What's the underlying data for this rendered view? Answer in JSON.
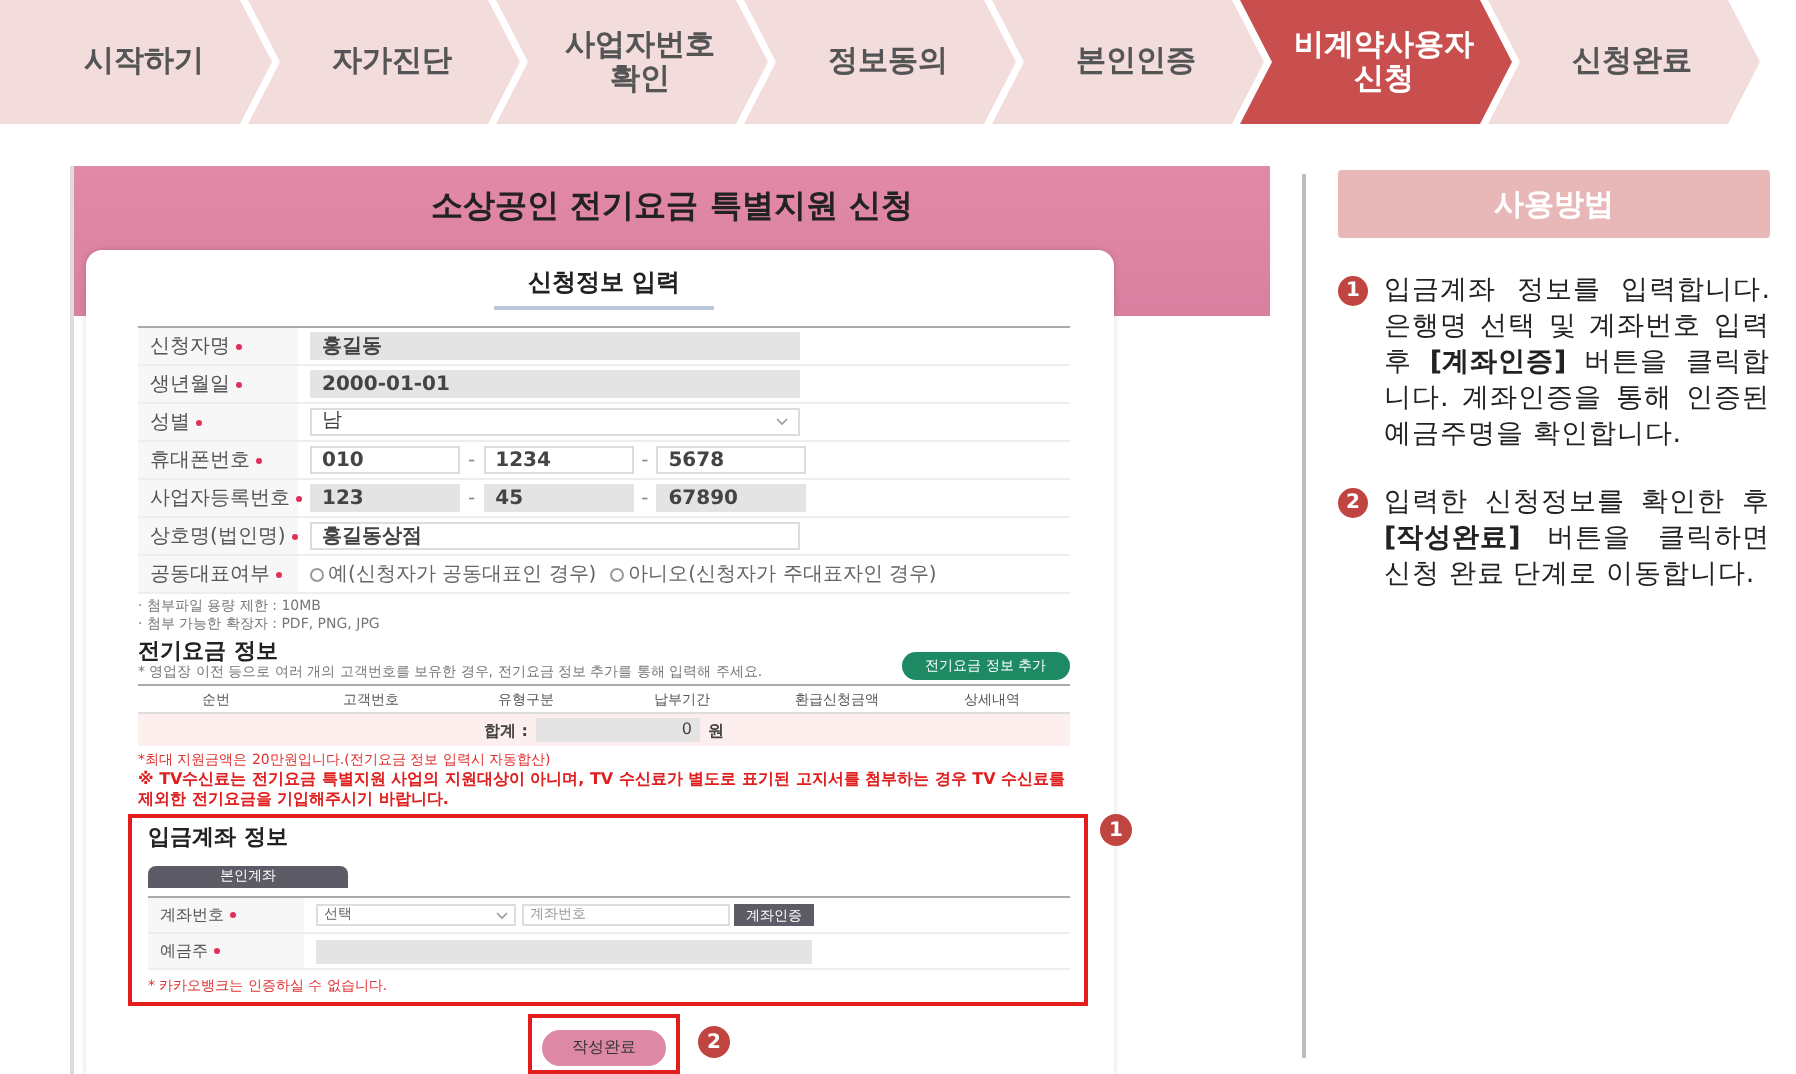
{
  "steps": [
    {
      "label": "시작하기",
      "selected": false
    },
    {
      "label": "자가진단",
      "selected": false
    },
    {
      "label": "사업자번호\n확인",
      "selected": false
    },
    {
      "label": "정보동의",
      "selected": false
    },
    {
      "label": "본인인증",
      "selected": false
    },
    {
      "label": "비계약사용자\n신청",
      "selected": true
    },
    {
      "label": "신청완료",
      "selected": false
    }
  ],
  "form": {
    "page_title": "소상공인 전기요금 특별지원 신청",
    "section_title": "신청정보 입력",
    "fields": [
      {
        "kind": "text",
        "label": "신청자명",
        "required": true,
        "disabled": true,
        "values": [
          "홍길동"
        ]
      },
      {
        "kind": "text",
        "label": "생년월일",
        "required": true,
        "disabled": true,
        "values": [
          "2000-01-01"
        ]
      },
      {
        "kind": "select",
        "label": "성별",
        "required": true,
        "disabled": false,
        "values": [
          "남"
        ]
      },
      {
        "kind": "split",
        "label": "휴대폰번호",
        "required": true,
        "disabled": false,
        "separator": "-",
        "values": [
          "010",
          "1234",
          "5678"
        ]
      },
      {
        "kind": "split",
        "label": "사업자등록번호",
        "required": true,
        "disabled": true,
        "separator": "-",
        "values": [
          "123",
          "45",
          "67890"
        ]
      },
      {
        "kind": "text",
        "label": "상호명(법인명)",
        "required": true,
        "disabled": false,
        "values": [
          "홍길동상점"
        ]
      },
      {
        "kind": "radio",
        "label": "공동대표여부",
        "required": true,
        "options": [
          {
            "label": "예(신청자가 공동대표인 경우)",
            "selected": false
          },
          {
            "label": "아니오(신청자가 주대표자인 경우)",
            "selected": false
          }
        ]
      }
    ],
    "file_notes": [
      "· 첨부파일 용량 제한 : 10MB",
      "· 첨부 가능한 확장자 : PDF, PNG, JPG"
    ],
    "bill": {
      "title": "전기요금 정보",
      "hint": "* 영업장 이전 등으로 여러 개의 고객번호를 보유한 경우, 전기요금 정보 추가를 통해 입력해 주세요.",
      "add_button": "전기요금 정보 추가",
      "columns": [
        "순번",
        "고객번호",
        "유형구분",
        "납부기간",
        "환급신청금액",
        "상세내역"
      ],
      "total_label": "합계 :",
      "total_value": "0",
      "total_unit": "원",
      "notes": [
        "*최대 지원금액은 20만원입니다.(전기요금 정보 입력시 자동합산)",
        "※ TV수신료는 전기요금 특별지원 사업의 지원대상이 아니며, TV 수신료가 별도로 표기된 고지서를 첨부하는 경우 TV 수신료를 제외한 전기요금을 기입해주시기 바랍니다."
      ]
    },
    "account": {
      "title": "입금계좌 정보",
      "tab": {
        "label": "본인계좌",
        "selected": true
      },
      "account_label": "계좌번호",
      "bank_select": "선택",
      "account_placeholder": "계좌번호",
      "verify_button": "계좌인증",
      "holder_label": "예금주",
      "note": "* 카카오뱅크는 인증하실 수 없습니다.",
      "callout": "1"
    },
    "submit": {
      "label": "작성완료",
      "callout": "2"
    }
  },
  "guide": {
    "title": "사용방법",
    "items": [
      {
        "number": "1",
        "text": "입금계좌 정보를 입력합니다. 은행명 선택 및 계좌번호 입력 후 **[계좌인증]** 버튼을 클릭합니다. 계좌인증을 통해 인증된 예금주명을 확인합니다."
      },
      {
        "number": "2",
        "text": "입력한 신청정보를 확인한 후 **[작성완료]** 버튼을 클릭하면 신청 완료 단계로 이동합니다."
      }
    ]
  }
}
